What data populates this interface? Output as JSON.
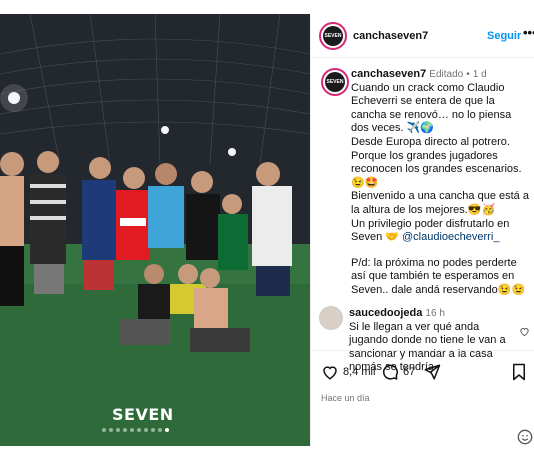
{
  "post": {
    "username": "canchaseven7",
    "follow_label": "Seguir",
    "more_icon": "•••",
    "avatar_text": "SEVEN",
    "photo": {
      "logo_text": "SEVEN",
      "dots_count": 10,
      "active_dot": 9
    }
  },
  "caption": {
    "username": "canchaseven7",
    "edited_label": "Editado",
    "time": "1 d",
    "lines": [
      "Cuando un crack como Claudio Echeverri se entera de que la cancha se renovó… no lo piensa dos veces. ✈️🌍",
      "Desde Europa directo al potrero.",
      "Porque los grandes jugadores reconocen los grandes escenarios.😉🤩",
      "Bienvenido a una cancha que está a la altura de los mejores.😎🥳",
      "Un privilegio poder disfrutarlo en Seven 🤝"
    ],
    "mention": "@claudioecheverri_",
    "ps": "P/d: la próxima no podes perderte así que también te esperamos en Seven.. dale andá reservando😉😉"
  },
  "comment": {
    "username": "saucedoojeda",
    "time": "16 h",
    "text": "Si le llegan a ver qué anda jugando donde no tiene le van a sancionar y mandar a la casa nomás se tendría"
  },
  "actions": {
    "likes": "8,4 mil",
    "comments": "67",
    "time_ago": "Hace un día"
  },
  "colors": {
    "accent": "#0095f6",
    "text": "#111111",
    "muted": "#737373",
    "mention": "#00376b"
  }
}
